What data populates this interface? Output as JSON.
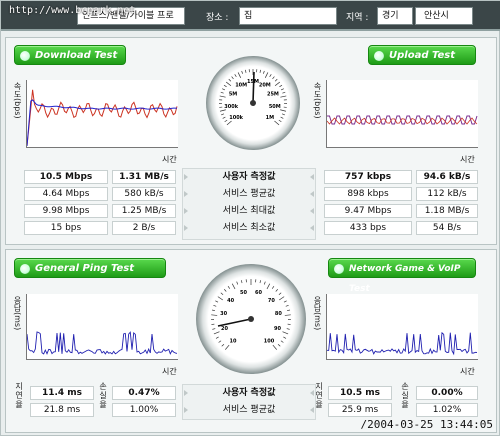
{
  "topbar": {
    "watermark": "http://www.bcpark.net",
    "provider_value": "인프스/밴텔/가이블 프로",
    "place_label": "장소 :",
    "place_value": "집",
    "region_label": "지역 :",
    "region_value1": "경기",
    "region_value2": "안산시"
  },
  "speed": {
    "download_title": "Download Test",
    "upload_title": "Upload Test",
    "y_label": "속도(bps)",
    "x_label": "시간",
    "row_labels": [
      "사용자 측정값",
      "서비스 평균값",
      "서비스 최대값",
      "서비스 최소값"
    ],
    "download": [
      [
        "10.5 Mbps",
        "1.31 MB/s"
      ],
      [
        "4.64 Mbps",
        "580 kB/s"
      ],
      [
        "9.98 Mbps",
        "1.25 MB/s"
      ],
      [
        "15 bps",
        "2 B/s"
      ]
    ],
    "upload": [
      [
        "757 kbps",
        "94.6 kB/s"
      ],
      [
        "898 kbps",
        "112 kB/s"
      ],
      [
        "9.47 Mbps",
        "1.18 MB/s"
      ],
      [
        "433 bps",
        "54 B/s"
      ]
    ],
    "gauge_ticks": [
      "100k",
      "300k",
      "5M",
      "10M",
      "15M",
      "20M",
      "25M",
      "50M",
      "1M"
    ]
  },
  "ping": {
    "ping_title": "General Ping Test",
    "game_title": "Network Game & VoIP Test",
    "y_label": "응답(ms)",
    "x_label": "시간",
    "row_labels": [
      "사용자 측정값",
      "서비스 평균값"
    ],
    "side_delay": "지연율",
    "side_loss": "손실율",
    "ping": [
      [
        "11.4 ms",
        "0.47%"
      ],
      [
        "21.8 ms",
        "1.00%"
      ]
    ],
    "game": [
      [
        "10.5 ms",
        "0.00%"
      ],
      [
        "25.9 ms",
        "1.02%"
      ]
    ],
    "gauge_ticks": [
      "10",
      "20",
      "30",
      "40",
      "50",
      "60",
      "70",
      "80",
      "90",
      "100"
    ]
  },
  "timestamp": "2004-03-25 13:44:05",
  "colors": {
    "pill_green": "#2fbf25",
    "dl_line_blue": "#2222cc",
    "dl_line_red": "#cc3322",
    "ul_line_purple": "#7a2f8f",
    "ping_line_blue": "#2020b0"
  }
}
